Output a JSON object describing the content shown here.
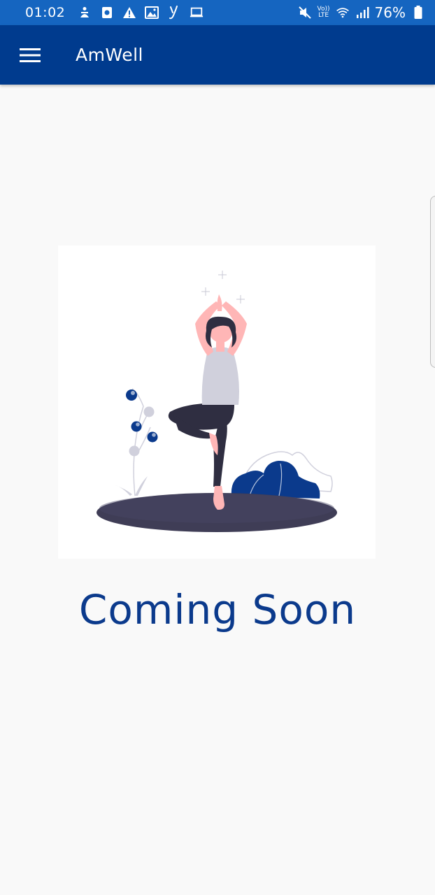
{
  "status_bar": {
    "time": "01:02",
    "lte_top": "Vo))",
    "lte_bottom": "LTE",
    "battery": "76%"
  },
  "app_bar": {
    "title": "AmWell"
  },
  "main": {
    "message": "Coming Soon"
  },
  "colors": {
    "status_bar_bg": "#1565c0",
    "app_bar_bg": "#003b8e",
    "accent": "#0b3a8c",
    "ground": "#3f3d56"
  }
}
